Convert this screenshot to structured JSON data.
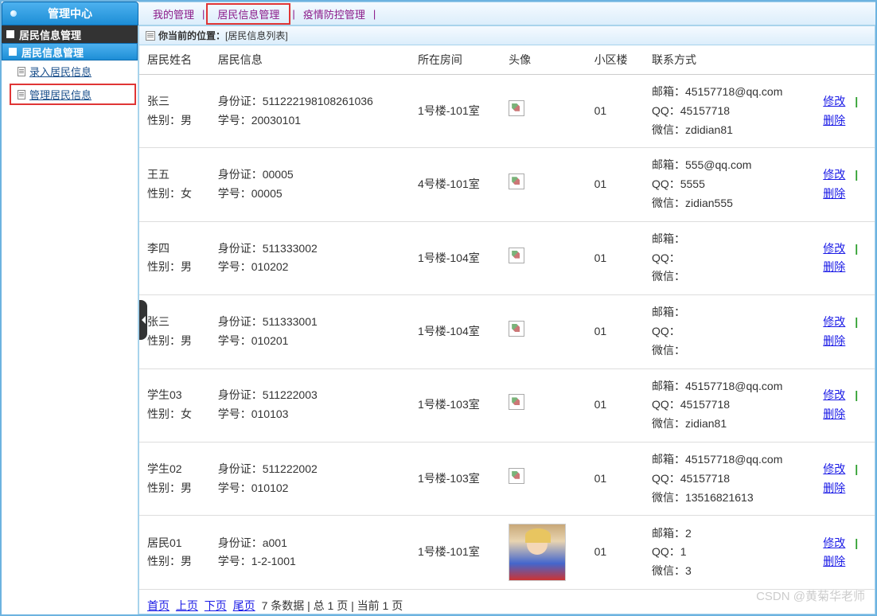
{
  "header": {
    "title": "管理中心"
  },
  "topnav": {
    "items": [
      {
        "label": "我的管理",
        "highlight": false
      },
      {
        "label": "居民信息管理",
        "highlight": true
      },
      {
        "label": "疫情防控管理",
        "highlight": false
      }
    ],
    "separator": "|"
  },
  "sidebar": {
    "title": "居民信息管理",
    "subtitle": "居民信息管理",
    "items": [
      {
        "label": "录入居民信息",
        "highlight": false
      },
      {
        "label": "管理居民信息",
        "highlight": true
      }
    ]
  },
  "breadcrumb": {
    "prefix": "你当前的位置：",
    "path": "[居民信息列表]"
  },
  "table": {
    "columns": [
      "居民姓名",
      "居民信息",
      "所在房间",
      "头像",
      "小区楼",
      "联系方式",
      ""
    ],
    "rows": [
      {
        "name": "张三",
        "gender": "性别：男",
        "id": "身份证：511222198108261036",
        "sno": "学号：20030101",
        "room": "1号楼-101室",
        "avatar": "broken",
        "building": "01",
        "email": "邮箱：45157718@qq.com",
        "qq": "QQ：45157718",
        "wechat": "微信：zdidian81"
      },
      {
        "name": "王五",
        "gender": "性别：女",
        "id": "身份证：00005",
        "sno": "学号：00005",
        "room": "4号楼-101室",
        "avatar": "broken",
        "building": "01",
        "email": "邮箱：555@qq.com",
        "qq": "QQ：5555",
        "wechat": "微信：zidian555"
      },
      {
        "name": "李四",
        "gender": "性别：男",
        "id": "身份证：511333002",
        "sno": "学号：010202",
        "room": "1号楼-104室",
        "avatar": "broken",
        "building": "01",
        "email": "邮箱：",
        "qq": "QQ：",
        "wechat": "微信："
      },
      {
        "name": "张三",
        "gender": "性别：男",
        "id": "身份证：511333001",
        "sno": "学号：010201",
        "room": "1号楼-104室",
        "avatar": "broken",
        "building": "01",
        "email": "邮箱：",
        "qq": "QQ：",
        "wechat": "微信："
      },
      {
        "name": "学生03",
        "gender": "性别：女",
        "id": "身份证：511222003",
        "sno": "学号：010103",
        "room": "1号楼-103室",
        "avatar": "broken",
        "building": "01",
        "email": "邮箱：45157718@qq.com",
        "qq": "QQ：45157718",
        "wechat": "微信：zidian81"
      },
      {
        "name": "学生02",
        "gender": "性别：男",
        "id": "身份证：511222002",
        "sno": "学号：010102",
        "room": "1号楼-103室",
        "avatar": "broken",
        "building": "01",
        "email": "邮箱：45157718@qq.com",
        "qq": "QQ：45157718",
        "wechat": "微信：13516821613"
      },
      {
        "name": "居民01",
        "gender": "性别：男",
        "id": "身份证：a001",
        "sno": "学号：1-2-1001",
        "room": "1号楼-101室",
        "avatar": "image",
        "building": "01",
        "email": "邮箱：2",
        "qq": "QQ：1",
        "wechat": "微信：3"
      }
    ],
    "actions": {
      "edit": "修改",
      "delete": "删除",
      "sep": "|"
    }
  },
  "pager": {
    "first": "首页",
    "prev": "上页",
    "next": "下页",
    "last": "尾页",
    "summary": "7 条数据 | 总 1 页 | 当前 1 页"
  },
  "watermark": "CSDN @黄菊华老师"
}
